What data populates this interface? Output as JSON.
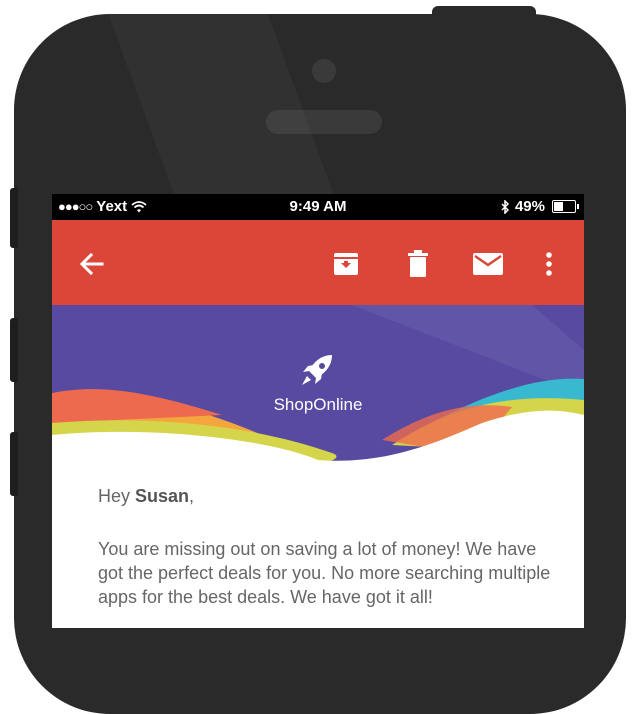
{
  "status_bar": {
    "signal": "●●●○○",
    "carrier": "Yext",
    "time": "9:49 AM",
    "battery_percent": "49%",
    "battery_level": 0.49,
    "icons": [
      "wifi-icon",
      "bluetooth-icon",
      "battery-icon"
    ]
  },
  "toolbar": {
    "background": "#db4638",
    "icons": [
      "back-arrow-icon",
      "archive-icon",
      "trash-icon",
      "mail-icon",
      "more-vert-icon"
    ]
  },
  "email": {
    "brand": "ShopOnline",
    "brand_icon": "rocket-icon",
    "banner_color": "#574aa0",
    "greeting_prefix": "Hey ",
    "recipient": "Susan",
    "greeting_suffix": ",",
    "message": "You are missing out on saving a lot of money! We have got the perfect deals for you. No more searching multiple apps for the best deals. We have got it all!"
  }
}
